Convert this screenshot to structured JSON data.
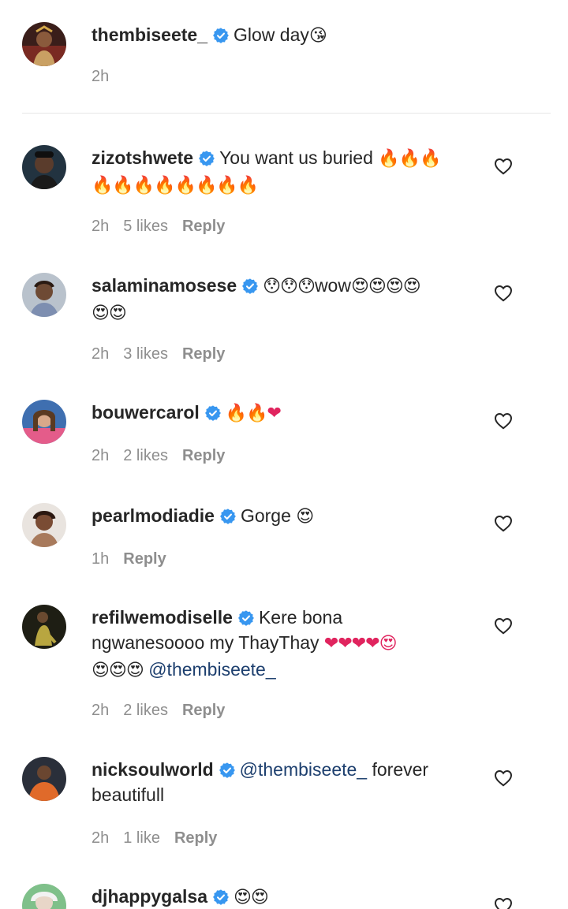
{
  "caption": {
    "username": "thembiseete_",
    "text": "Glow day",
    "emoji": "😘",
    "time": "2h"
  },
  "comments": [
    {
      "username": "zizotshwete",
      "line1_text": "You want us buried",
      "line1_emoji": "🔥🔥🔥",
      "line2_emoji": "🔥🔥🔥🔥🔥🔥🔥🔥",
      "time": "2h",
      "likes": "5 likes",
      "reply": "Reply"
    },
    {
      "username": "salaminamosese",
      "line1_emoji_a": "😯😯😯",
      "line1_text": "wow",
      "line1_emoji_b": "😍😍😍😍",
      "line2_emoji": "😍😍",
      "time": "2h",
      "likes": "3 likes",
      "reply": "Reply"
    },
    {
      "username": "bouwercarol",
      "line1_emoji": "🔥🔥❤",
      "time": "2h",
      "likes": "2 likes",
      "reply": "Reply"
    },
    {
      "username": "pearlmodiadie",
      "line1_text": "Gorge",
      "line1_emoji": "😍",
      "time": "1h",
      "reply": "Reply"
    },
    {
      "username": "refilwemodiselle",
      "line1_text": "Kere bona",
      "line2_text": "ngwanesoooo my ThayThay",
      "line2_emoji": "❤❤❤❤😍",
      "line3_emoji": "😍😍😍",
      "mention": "@thembiseete_",
      "time": "2h",
      "likes": "2 likes",
      "reply": "Reply"
    },
    {
      "username": "nicksoulworld",
      "mention": "@thembiseete_",
      "line1_text": "forever",
      "line2_text": "beautifull",
      "time": "2h",
      "likes": "1 like",
      "reply": "Reply"
    },
    {
      "username": "djhappygalsa",
      "line1_emoji": "😍😍"
    }
  ],
  "colors": {
    "verified": "#3897f0",
    "secondary_text": "#8e8e8e",
    "mention": "#1d3f6e",
    "divider": "#e6e6e6"
  },
  "icons": [
    "verified-badge-icon",
    "heart-outline-icon"
  ]
}
